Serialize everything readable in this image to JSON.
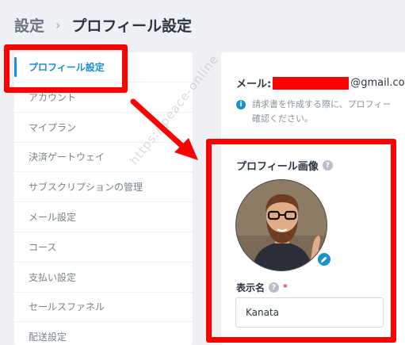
{
  "breadcrumb": {
    "root": "設定",
    "separator": "›",
    "current": "プロフィール設定"
  },
  "sidebar": {
    "items": [
      {
        "label": "プロフィール設定",
        "active": true
      },
      {
        "label": "アカウント"
      },
      {
        "label": "マイプラン"
      },
      {
        "label": "決済ゲートウェイ"
      },
      {
        "label": "サブスクリプションの管理"
      },
      {
        "label": "メール設定"
      },
      {
        "label": "コース"
      },
      {
        "label": "支払い設定"
      },
      {
        "label": "セールスファネル"
      },
      {
        "label": "配送設定"
      }
    ]
  },
  "main": {
    "email_label": "メール:",
    "email_domain": "@gmail.com",
    "notice": "請求書を作成する際に、プロフィー確認ください。",
    "notice_line1": "請求書を作成する際に、プロフィー",
    "notice_line2": "確認ください。",
    "profile_image_title": "プロフィール画像",
    "display_name_label": "表示名",
    "required_mark": "*",
    "display_name_value": "Kanata"
  },
  "watermark": "https://peace-online",
  "colors": {
    "accent": "#1a8fd1",
    "highlight": "#ff0000",
    "background": "#eef0f3"
  },
  "icons": {
    "info": "info-icon",
    "help": "help-icon",
    "edit": "pencil-icon"
  }
}
